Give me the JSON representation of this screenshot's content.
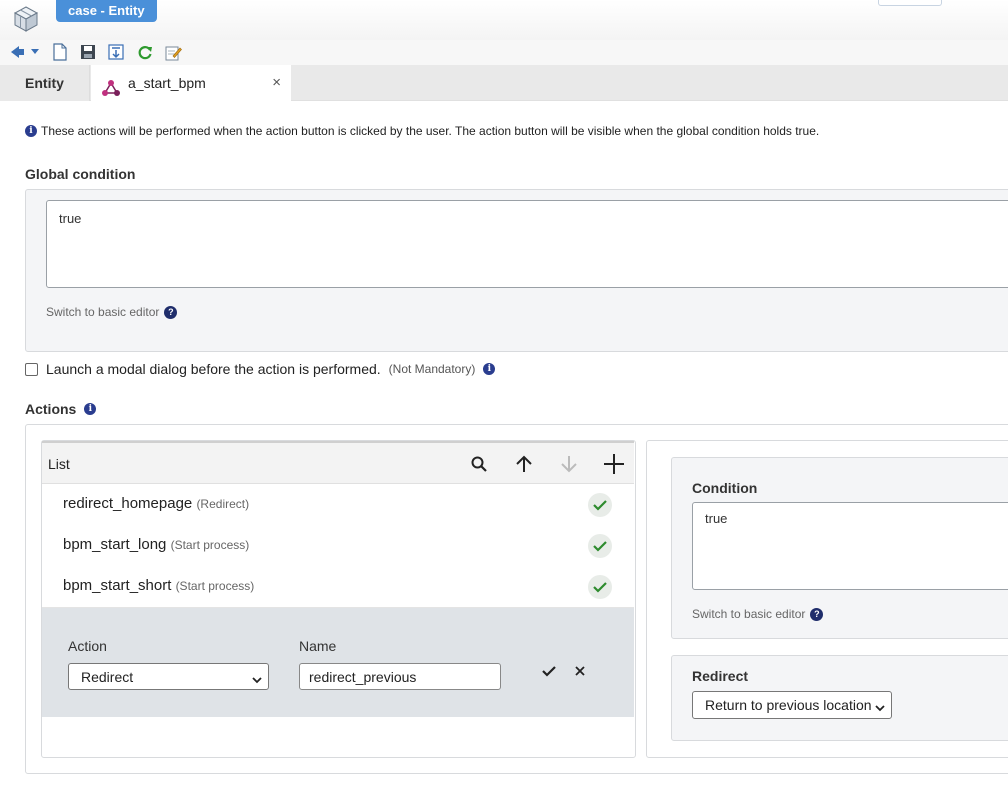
{
  "window": {
    "title": "case - Entity"
  },
  "tabs": [
    {
      "label": "Entity"
    },
    {
      "label": "a_start_bpm",
      "close": "×"
    }
  ],
  "info": {
    "text": "These actions will be performed when the action button is clicked by the user. The action button will be visible when the global condition holds true."
  },
  "global_condition": {
    "label": "Global condition",
    "value": "true",
    "switch_link": "Switch to basic editor"
  },
  "modal": {
    "label": "Launch a modal dialog before the action is performed.",
    "note": "(Not Mandatory)"
  },
  "actions": {
    "label": "Actions",
    "list": {
      "title": "List",
      "rows": [
        {
          "name": "redirect_homepage",
          "type": "(Redirect)"
        },
        {
          "name": "bpm_start_long",
          "type": "(Start process)"
        },
        {
          "name": "bpm_start_short",
          "type": "(Start process)"
        }
      ],
      "editor": {
        "action_label": "Action",
        "action_value": "Redirect",
        "name_label": "Name",
        "name_value": "redirect_previous"
      }
    },
    "detail": {
      "condition_label": "Condition",
      "condition_value": "true",
      "switch_link": "Switch to basic editor",
      "redirect_label": "Redirect",
      "redirect_value": "Return to previous location"
    }
  },
  "colors": {
    "title_tab": "#4a90d9",
    "info_icon": "#2a3d8f",
    "check_green": "#2e8b2e",
    "edit_area": "#dfe3e7"
  }
}
